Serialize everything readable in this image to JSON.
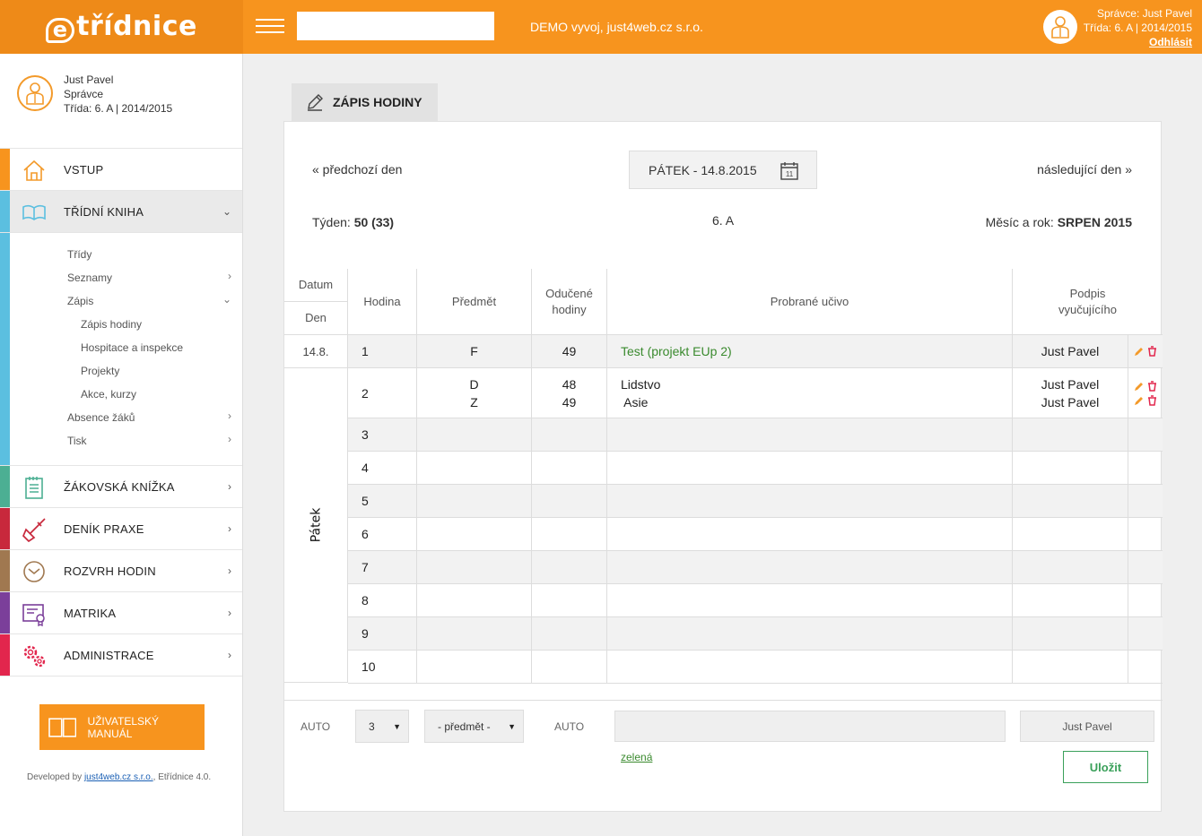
{
  "brand": {
    "logo_text": "třídnice",
    "accent": "#f7941e",
    "accent_dark": "#ee8a18"
  },
  "header": {
    "company": "DEMO vyvoj, just4web.cz s.r.o.",
    "role_line": "Správce: Just Pavel",
    "class_line": "Třída: 6. A | 2014/2015",
    "logout": "Odhlásit"
  },
  "profile": {
    "name": "Just Pavel",
    "role": "Správce",
    "class_line": "Třída: 6. A | 2014/2015"
  },
  "sidebar": {
    "items": [
      {
        "label": "VSTUP",
        "icon": "home-icon",
        "color": "#f7941e"
      },
      {
        "label": "TŘÍDNÍ KNIHA",
        "icon": "book-icon",
        "color": "#5bbfe0",
        "chevron": "⌄"
      },
      {
        "label": "ŽÁKOVSKÁ KNÍŽKA",
        "icon": "notebook-icon",
        "color": "#4caf93",
        "chevron": "›"
      },
      {
        "label": "DENÍK PRAXE",
        "icon": "shovel-icon",
        "color": "#c8283c",
        "chevron": "›"
      },
      {
        "label": "ROZVRH HODIN",
        "icon": "clock-icon",
        "color": "#a07850",
        "chevron": "›"
      },
      {
        "label": "MATRIKA",
        "icon": "certificate-icon",
        "color": "#7b3f9a",
        "chevron": "›"
      },
      {
        "label": "ADMINISTRACE",
        "icon": "gears-icon",
        "color": "#e2264d",
        "chevron": "›"
      }
    ],
    "submenu": [
      {
        "label": "Třídy",
        "chevron": ""
      },
      {
        "label": "Seznamy",
        "chevron": "›"
      },
      {
        "label": "Zápis",
        "chevron": "⌄"
      },
      {
        "label": "Zápis hodiny",
        "chevron": ""
      },
      {
        "label": "Hospitace a inspekce",
        "chevron": ""
      },
      {
        "label": "Projekty",
        "chevron": ""
      },
      {
        "label": "Akce, kurzy",
        "chevron": ""
      },
      {
        "label": "Absence žáků",
        "chevron": "›"
      },
      {
        "label": "Tisk",
        "chevron": "›"
      }
    ],
    "manual_label": "UŽIVATELSKÝ MANUÁL",
    "credit_prefix": "Developed by ",
    "credit_link": "just4web.cz s.r.o.",
    "credit_suffix": ", Etřídnice 4.0."
  },
  "main": {
    "tab_label": "ZÁPIS HODINY",
    "prev_day": "« předchozí den",
    "next_day": "následující den »",
    "date": "PÁTEK - 14.8.2015",
    "calendar_day": "11",
    "week_label": "Týden:",
    "week_value": "50 (33)",
    "class": "6. A",
    "month_label": "Měsíc a rok:",
    "month_value": "SRPEN 2015"
  },
  "table": {
    "headers": {
      "datum": "Datum",
      "den": "Den",
      "hodina": "Hodina",
      "predmet": "Předmět",
      "oducene_1": "Odučené",
      "oducene_2": "hodiny",
      "ucivo": "Probrané učivo",
      "podpis_1": "Podpis",
      "podpis_2": "vyučujícího"
    },
    "date_cell": "14.8.",
    "day_cell": "Pátek",
    "rows": [
      {
        "hour": "1",
        "subjects": [
          "F"
        ],
        "counts": [
          "49"
        ],
        "topics": [
          "Test (projekt EUp 2)"
        ],
        "teachers": [
          "Just Pavel"
        ]
      },
      {
        "hour": "2",
        "subjects": [
          "D",
          "Z"
        ],
        "counts": [
          "48",
          "49"
        ],
        "topics": [
          "Lidstvo",
          " Asie"
        ],
        "teachers": [
          "Just Pavel",
          "Just Pavel"
        ]
      },
      {
        "hour": "3"
      },
      {
        "hour": "4"
      },
      {
        "hour": "5"
      },
      {
        "hour": "6"
      },
      {
        "hour": "7"
      },
      {
        "hour": "8"
      },
      {
        "hour": "9"
      },
      {
        "hour": "10"
      }
    ]
  },
  "form": {
    "auto_label_1": "AUTO",
    "hour_select": "3",
    "subject_select": "- předmět -",
    "auto_label_2": "AUTO",
    "teacher": "Just Pavel",
    "color_link": "zelená",
    "save": "Uložit"
  }
}
